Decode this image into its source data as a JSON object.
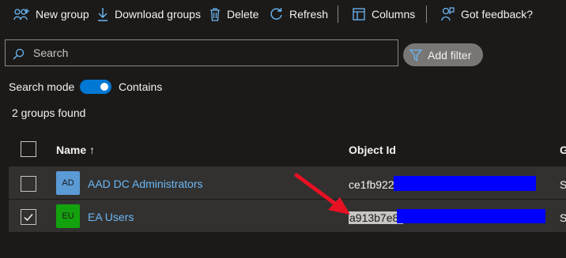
{
  "toolbar": {
    "new_group": "New group",
    "download_groups": "Download groups",
    "delete": "Delete",
    "refresh": "Refresh",
    "columns": "Columns",
    "feedback": "Got feedback?"
  },
  "search": {
    "placeholder": "Search",
    "value": ""
  },
  "filter": {
    "add_filter_label": "Add filter"
  },
  "search_mode": {
    "label": "Search mode",
    "toggle_on": true,
    "value_label": "Contains"
  },
  "results": {
    "count_text": "2 groups found"
  },
  "table": {
    "headers": {
      "name": "Name ↑",
      "object_id": "Object Id",
      "next": "G"
    },
    "rows": [
      {
        "checked": false,
        "avatar": "AD",
        "avatar_color": "#5b9bd5",
        "name": "AAD DC Administrators",
        "object_id": "ce1fb922-",
        "next": "S"
      },
      {
        "checked": true,
        "avatar": "EU",
        "avatar_color": "#13a10e",
        "name": "EA Users",
        "object_id": "a913b7e8-",
        "next": "S"
      }
    ]
  },
  "colors": {
    "accent": "#0078d4",
    "link": "#6cb8f6",
    "redaction": "#0000ff",
    "annotation_arrow": "#e81123"
  }
}
